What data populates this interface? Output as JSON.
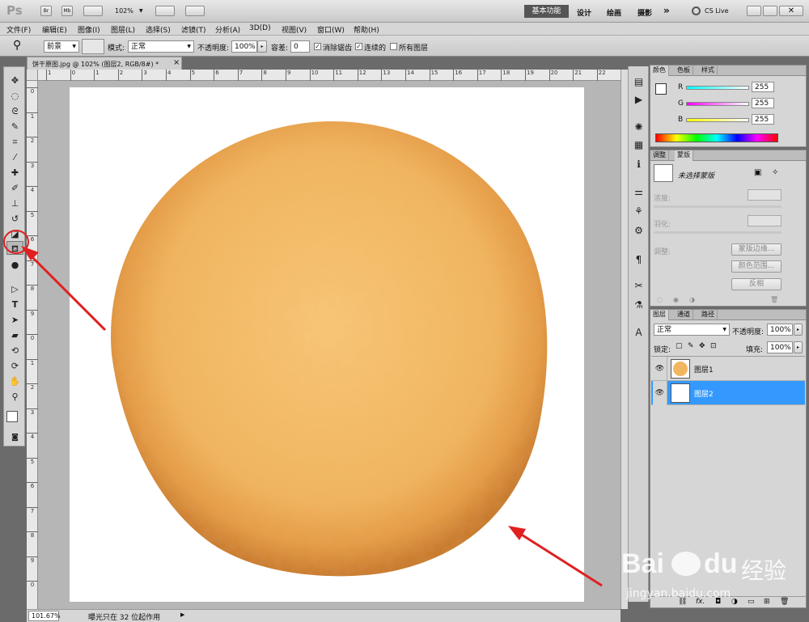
{
  "app": {
    "logo": "Ps",
    "zoom": "102%",
    "workspace_active": "基本功能",
    "workspaces": [
      "设计",
      "绘画",
      "摄影"
    ],
    "more": "»",
    "cs_live": "CS Live"
  },
  "menu": [
    "文件(F)",
    "编辑(E)",
    "图像(I)",
    "图层(L)",
    "选择(S)",
    "滤镜(T)",
    "分析(A)",
    "3D(D)",
    "视图(V)",
    "窗口(W)",
    "帮助(H)"
  ],
  "options": {
    "fill_source": "前景",
    "mode_label": "模式:",
    "mode_value": "正常",
    "opacity_label": "不透明度:",
    "opacity_value": "100%",
    "tolerance_label": "容差:",
    "tolerance_value": "0",
    "antialias_label": "消除锯齿",
    "antialias_checked": true,
    "contiguous_label": "连续的",
    "contiguous_checked": true,
    "all_layers_label": "所有图层",
    "all_layers_checked": false
  },
  "document": {
    "tab_title": "饼干原图.jpg @ 102% (图层2, RGB/8#) *",
    "close": "×",
    "ruler_h": [
      "1",
      "0",
      "1",
      "2",
      "3",
      "4",
      "5",
      "6",
      "7",
      "8",
      "9",
      "10",
      "11",
      "12",
      "13",
      "14",
      "15",
      "16",
      "17",
      "18",
      "19",
      "20",
      "21",
      "22"
    ],
    "ruler_v": [
      "0",
      "1",
      "2",
      "3",
      "4",
      "5",
      "6",
      "7",
      "8",
      "9",
      "0",
      "1",
      "2",
      "3",
      "4",
      "5",
      "6",
      "7",
      "8",
      "9",
      "0"
    ]
  },
  "status": {
    "zoom": "101.67%",
    "message": "曝光只在 32 位起作用"
  },
  "color_panel": {
    "tabs": [
      "颜色",
      "色板",
      "样式"
    ],
    "channels": [
      {
        "label": "R",
        "value": "255"
      },
      {
        "label": "G",
        "value": "255"
      },
      {
        "label": "B",
        "value": "255"
      }
    ]
  },
  "adjust_panel": {
    "tabs": [
      "调整",
      "蒙版"
    ],
    "no_mask": "未选择蒙版",
    "density": "浓度:",
    "feather": "羽化:",
    "refine": "调整:",
    "btn_edge": "蒙版边缘...",
    "btn_range": "颜色范围...",
    "btn_invert": "反相"
  },
  "layers_panel": {
    "tabs": [
      "图层",
      "通道",
      "路径"
    ],
    "blend": "正常",
    "opacity_label": "不透明度:",
    "opacity_value": "100%",
    "lock_label": "锁定:",
    "fill_label": "填充:",
    "fill_value": "100%",
    "layers": [
      {
        "name": "图层1",
        "selected": false
      },
      {
        "name": "图层2",
        "selected": true
      }
    ],
    "footer_fx": "fx."
  },
  "watermark": {
    "brand": "Bai",
    "brand2": "du",
    "suffix": "经验",
    "url": "jingyan.baidu.com"
  },
  "colors": {
    "selection_blue": "#3399ff",
    "annotation_red": "#e02020",
    "cookie_base": "#f2b560",
    "cookie_edge": "#c8782a"
  }
}
